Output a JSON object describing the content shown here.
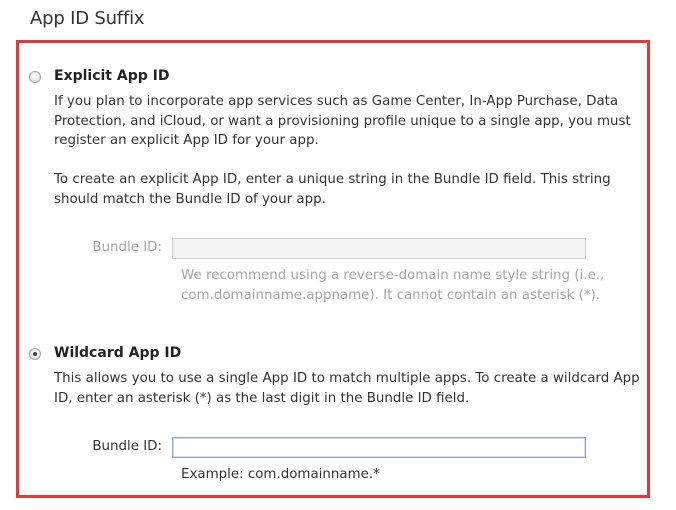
{
  "section": {
    "title": "App ID Suffix"
  },
  "explicit": {
    "label": "Explicit App ID",
    "selected": false,
    "desc1": "If you plan to incorporate app services such as Game Center, In-App Purchase, Data Protection, and iCloud, or want a provisioning profile unique to a single app, you must register an explicit App ID for your app.",
    "desc2": "To create an explicit App ID, enter a unique string in the Bundle ID field. This string should match the Bundle ID of your app.",
    "field_label": "Bundle ID:",
    "field_value": "",
    "hint": "We recommend using a reverse-domain name style string (i.e., com.domainname.appname). It cannot contain an asterisk (*)."
  },
  "wildcard": {
    "label": "Wildcard App ID",
    "selected": true,
    "desc": "This allows you to use a single App ID to match multiple apps. To create a wildcard App ID, enter an asterisk (*) as the last digit in the Bundle ID field.",
    "field_label": "Bundle ID:",
    "field_value": "",
    "example": "Example: com.domainname.*"
  },
  "colors": {
    "highlight_border": "#e2393c",
    "disabled_text": "#a6a6a6",
    "focus_border": "#8ea8d2"
  }
}
